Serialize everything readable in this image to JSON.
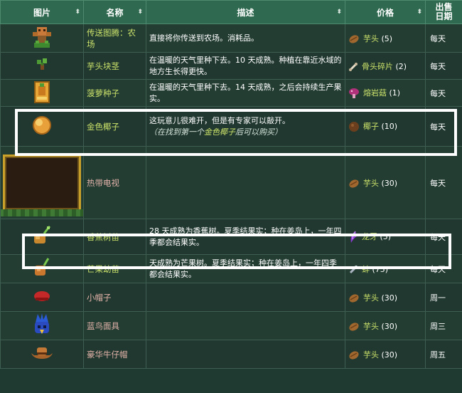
{
  "headers": {
    "image": "图片",
    "name": "名称",
    "desc": "描述",
    "price": "价格",
    "day_line1": "出售",
    "day_line2": "日期",
    "sort_glyph": "⬍"
  },
  "rows": [
    {
      "icon": "totem-farm-icon",
      "name": "传送图腾：农场",
      "desc": "直接将你传送到农场。消耗品。",
      "price_icon": "taro-icon",
      "price_name": "芋头",
      "price_qty": "(5)",
      "day": "每天"
    },
    {
      "icon": "taro-tuber-icon",
      "name": "芋头块茎",
      "desc": "在温暖的天气里种下去。10 天成熟。种植在靠近水域的地方生长得更快。",
      "price_icon": "bone-fragment-icon",
      "price_name": "骨头碎片",
      "price_qty": "(2)",
      "day": "每天"
    },
    {
      "icon": "pineapple-seed-icon",
      "name": "菠萝种子",
      "desc": "在温暖的天气里种下去。14 天成熟，之后会持续生产果实。",
      "price_icon": "magma-cap-icon",
      "price_name": "熔岩菇",
      "price_qty": "(1)",
      "day": "每天"
    },
    {
      "icon": "golden-coconut-icon",
      "name": "金色椰子",
      "desc": "这玩意儿很难开，但是有专家可以敲开。",
      "note_prefix": "（在找到第一个",
      "note_hl": "金色椰子",
      "note_suffix": "后可以购买）",
      "price_icon": "coconut-icon",
      "price_name": "椰子",
      "price_qty": "(10)",
      "day": "每天"
    },
    {
      "icon": "tropical-tv-icon",
      "name": "热带电视",
      "desc": "",
      "price_icon": "taro-icon",
      "price_name": "芋头",
      "price_qty": "(30)",
      "day": "每天"
    },
    {
      "icon": "banana-sapling-icon",
      "name": "香蕉树苗",
      "desc": "28 天成熟为香蕉树。夏季结果实；种在姜岛上，一年四季都会结果实。",
      "price_icon": "dragon-tooth-icon",
      "price_name": "龙牙",
      "price_qty": "(5)",
      "day": "每天"
    },
    {
      "icon": "mango-sapling-icon",
      "name": "芒果幼苗",
      "desc": "天成熟为芒果树。夏季结果实；种在姜岛上，一年四季都会结果实。",
      "price_icon": "mussel-icon",
      "price_name": "蚌",
      "price_qty": "(75)",
      "day": "每天"
    },
    {
      "icon": "small-cap-icon",
      "name": "小帽子",
      "desc": "",
      "price_icon": "taro-icon",
      "price_name": "芋头",
      "price_qty": "(30)",
      "day": "周一"
    },
    {
      "icon": "bluebird-mask-icon",
      "name": "蓝鸟面具",
      "desc": "",
      "price_icon": "taro-icon",
      "price_name": "芋头",
      "price_qty": "(30)",
      "day": "周三"
    },
    {
      "icon": "deluxe-cowboy-hat-icon",
      "name": "豪华牛仔帽",
      "desc": "",
      "price_icon": "taro-icon",
      "price_name": "芋头",
      "price_qty": "(30)",
      "day": "周五"
    }
  ]
}
